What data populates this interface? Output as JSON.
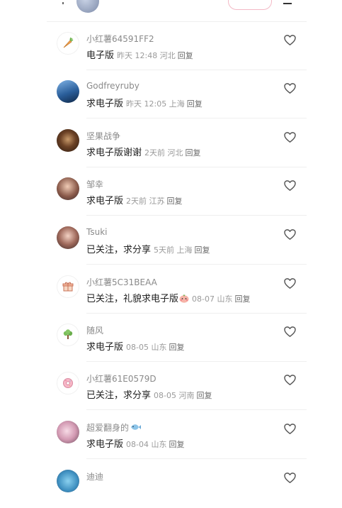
{
  "comments": [
    {
      "username": "小红薯64591FF2",
      "content": "电子版",
      "meta": "昨天 12:48 河北",
      "reply": "回复"
    },
    {
      "username": "Godfreyruby",
      "content": "求电子版",
      "meta": "昨天 12:05 上海",
      "reply": "回复"
    },
    {
      "username": "坚果战争",
      "content": "求电子版谢谢",
      "meta": "2天前  河北",
      "reply": "回复"
    },
    {
      "username": "邹幸",
      "content": "求电子版",
      "meta": "2天前  江苏",
      "reply": "回复"
    },
    {
      "username": "Tsuki",
      "content": "已关注，求分享",
      "meta": "5天前  上海",
      "reply": "回复"
    },
    {
      "username": "小红薯5C31BEAA",
      "content": "已关注，礼貌求电子版",
      "meta": "08-07 山东",
      "reply": "回复"
    },
    {
      "username": "随风",
      "content": "求电子版",
      "meta": "08-05 山东",
      "reply": "回复"
    },
    {
      "username": "小红薯61E0579D",
      "content": "已关注，求分享",
      "meta": "08-05 河南",
      "reply": "回复"
    },
    {
      "username": "超爱翻身的",
      "content": "求电子版",
      "meta": "08-04 山东",
      "reply": "回复"
    },
    {
      "username": "迪迪",
      "content": "",
      "meta": "",
      "reply": ""
    }
  ],
  "icons": {
    "like": "heart-outline-icon"
  }
}
